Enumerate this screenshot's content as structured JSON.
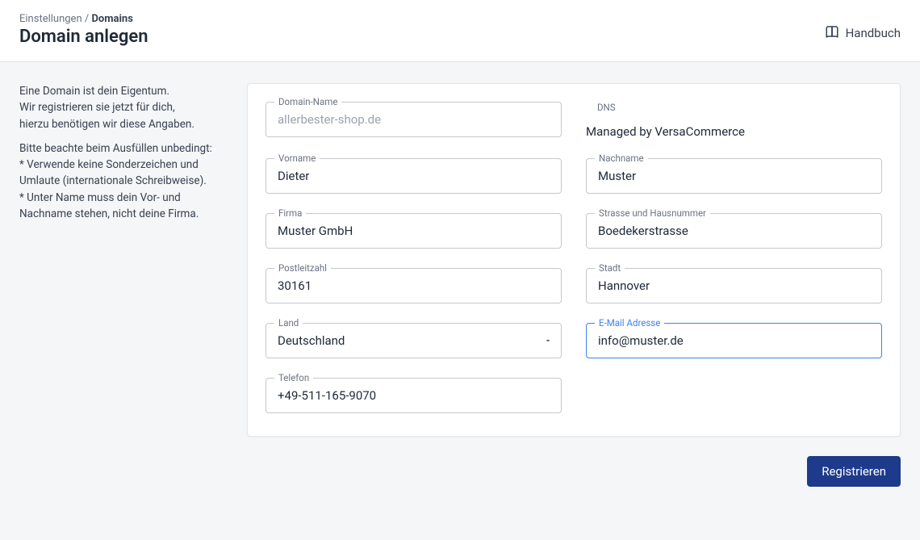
{
  "header": {
    "breadcrumb_parent": "Einstellungen",
    "breadcrumb_sep": " / ",
    "breadcrumb_current": "Domains",
    "title": "Domain anlegen",
    "manual_label": "Handbuch"
  },
  "sidebar": {
    "p1_l1": "Eine Domain ist dein Eigentum.",
    "p1_l2": "Wir registrieren sie jetzt für dich,",
    "p1_l3": "hierzu benötigen wir diese Angaben.",
    "p2_l1": "Bitte beachte beim Ausfüllen unbedingt:",
    "p2_l2": "* Verwende keine Sonderzeichen und Umlaute (internationale Schreibweise).",
    "p2_l3": "* Unter Name muss dein Vor- und Nachname stehen, nicht deine Firma."
  },
  "form": {
    "domain_name": {
      "label": "Domain-Name",
      "placeholder": "allerbester-shop.de",
      "value": ""
    },
    "dns": {
      "label": "DNS",
      "value": "Managed by VersaCommerce"
    },
    "vorname": {
      "label": "Vorname",
      "value": "Dieter"
    },
    "nachname": {
      "label": "Nachname",
      "value": "Muster"
    },
    "firma": {
      "label": "Firma",
      "value": "Muster GmbH"
    },
    "strasse": {
      "label": "Strasse und Hausnummer",
      "value": "Boedekerstrasse"
    },
    "plz": {
      "label": "Postleitzahl",
      "value": "30161"
    },
    "stadt": {
      "label": "Stadt",
      "value": "Hannover"
    },
    "land": {
      "label": "Land",
      "value": "Deutschland"
    },
    "email": {
      "label": "E-Mail Adresse",
      "value": "info@muster.de"
    },
    "telefon": {
      "label": "Telefon",
      "value": "+49-511-165-9070"
    }
  },
  "actions": {
    "register_label": "Registrieren"
  }
}
